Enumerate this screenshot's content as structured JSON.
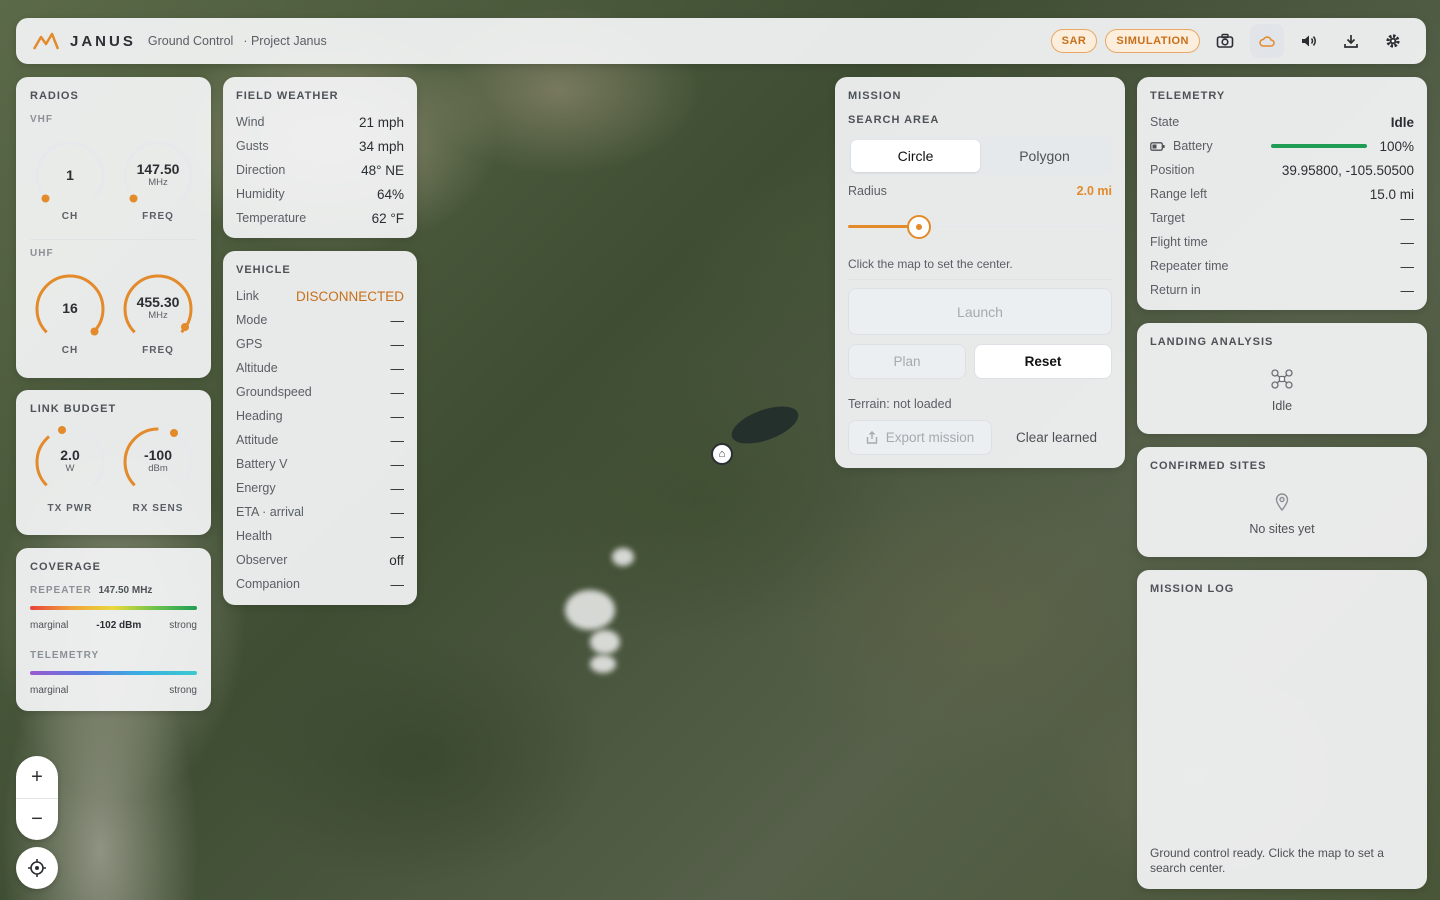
{
  "header": {
    "brand": "JANUS",
    "crumb1": "Ground Control",
    "crumb2": "· Project Janus",
    "badge_sar": "SAR",
    "badge_sim": "SIMULATION",
    "icons": [
      "camera-icon",
      "cloud-icon",
      "volume-icon",
      "download-icon",
      "gear-icon"
    ]
  },
  "radios": {
    "title": "RADIOS",
    "vhf": {
      "label": "VHF",
      "ch": "1",
      "ch_label": "CH",
      "freq": "147.50",
      "freq_unit": "MHz",
      "freq_label": "FREQ"
    },
    "uhf": {
      "label": "UHF",
      "ch": "16",
      "ch_label": "CH",
      "freq": "455.30",
      "freq_unit": "MHz",
      "freq_label": "FREQ"
    }
  },
  "link_budget": {
    "title": "LINK BUDGET",
    "tx": {
      "val": "2.0",
      "unit": "W",
      "label": "TX PWR"
    },
    "rx": {
      "val": "-100",
      "unit": "dBm",
      "label": "RX SENS"
    }
  },
  "coverage": {
    "title": "COVERAGE",
    "repeater_label": "REPEATER",
    "repeater_freq": "147.50 MHz",
    "rep_low": "marginal",
    "rep_value": "-102 dBm",
    "rep_high": "strong",
    "telemetry_label": "TELEMETRY",
    "tel_low": "marginal",
    "tel_high": "strong"
  },
  "weather": {
    "title": "FIELD WEATHER",
    "rows": [
      {
        "k": "Wind",
        "v": "21 mph"
      },
      {
        "k": "Gusts",
        "v": "34 mph"
      },
      {
        "k": "Direction",
        "v": "48° NE"
      },
      {
        "k": "Humidity",
        "v": "64%"
      },
      {
        "k": "Temperature",
        "v": "62 °F"
      }
    ]
  },
  "vehicle": {
    "title": "VEHICLE",
    "link_label": "Link",
    "link_value": "DISCONNECTED",
    "rows": [
      {
        "k": "Mode",
        "v": "—"
      },
      {
        "k": "GPS",
        "v": "—"
      },
      {
        "k": "Altitude",
        "v": "—"
      },
      {
        "k": "Groundspeed",
        "v": "—"
      },
      {
        "k": "Heading",
        "v": "—"
      },
      {
        "k": "Attitude",
        "v": "—"
      },
      {
        "k": "Battery V",
        "v": "—"
      },
      {
        "k": "Energy",
        "v": "—"
      },
      {
        "k": "ETA · arrival",
        "v": "—"
      },
      {
        "k": "Health",
        "v": "—"
      },
      {
        "k": "Observer",
        "v": "off"
      },
      {
        "k": "Companion",
        "v": "—"
      }
    ]
  },
  "mission": {
    "title": "MISSION",
    "search_area": "SEARCH AREA",
    "tab_circle": "Circle",
    "tab_polygon": "Polygon",
    "radius_label": "Radius",
    "radius_value": "2.0 mi",
    "radius_fraction": 0.27,
    "hint": "Click the map to set the center.",
    "launch": "Launch",
    "plan": "Plan",
    "reset": "Reset",
    "terrain": "Terrain: not loaded",
    "export": "Export mission",
    "clear": "Clear learned"
  },
  "telemetry": {
    "title": "TELEMETRY",
    "state_label": "State",
    "state_value": "Idle",
    "battery_label": "Battery",
    "battery_value": "100%",
    "battery_fraction": 1.0,
    "rows": [
      {
        "k": "Position",
        "v": "39.95800, -105.50500"
      },
      {
        "k": "Range left",
        "v": "15.0 mi"
      },
      {
        "k": "Target",
        "v": "—"
      },
      {
        "k": "Flight time",
        "v": "—"
      },
      {
        "k": "Repeater time",
        "v": "—"
      },
      {
        "k": "Return in",
        "v": "—"
      }
    ]
  },
  "landing": {
    "title": "LANDING ANALYSIS",
    "status": "Idle"
  },
  "sites": {
    "title": "CONFIRMED SITES",
    "empty": "No sites yet"
  },
  "log": {
    "title": "MISSION LOG",
    "message": "Ground control ready. Click the map to set a search center."
  },
  "map_controls": {
    "zoom_in": "+",
    "zoom_out": "−"
  },
  "colors": {
    "accent": "#e38a2b",
    "link_down": "#c86f1a",
    "battery": "#1f9d55"
  }
}
